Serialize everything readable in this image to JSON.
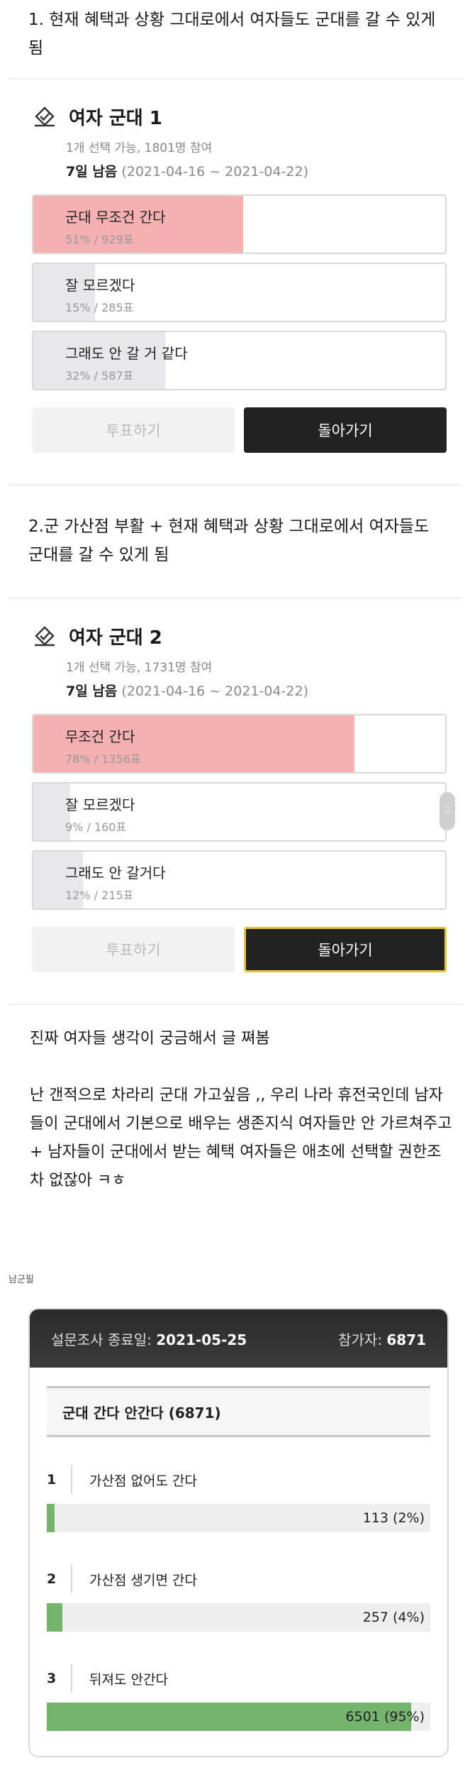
{
  "heading1": "1. 현재 혜택과 상황 그대로에서 여자들도 군대를 갈 수 있게 됨",
  "poll1": {
    "icon": "check-ballot-icon",
    "title": "여자 군대 1",
    "meta": "1개 선택 가능, 1801명 참여",
    "days_left": "7일 남음",
    "range": "(2021-04-16 ~ 2021-04-22)",
    "options": [
      {
        "label": "군대 무조건 간다",
        "count": "51% / 929표",
        "percent": 51
      },
      {
        "label": "잘 모르겠다",
        "count": "15% / 285표",
        "percent": 15
      },
      {
        "label": "그래도 안 갈 거 같다",
        "count": "32% / 587표",
        "percent": 32
      }
    ],
    "vote_label": "투표하기",
    "back_label": "돌아가기"
  },
  "heading2": "2.군 가산점 부활 + 현재 혜택과 상황 그대로에서 여자들도 군대를 갈 수 있게 됨",
  "poll2": {
    "icon": "check-ballot-icon",
    "title": "여자 군대 2",
    "meta": "1개 선택 가능, 1731명 참여",
    "days_left": "7일 남음",
    "range": "(2021-04-16 ~ 2021-04-22)",
    "options": [
      {
        "label": "무조건 간다",
        "count": "78% / 1356표",
        "percent": 78
      },
      {
        "label": "잘 모르겠다",
        "count": "9% / 160표",
        "percent": 9
      },
      {
        "label": "그래도 안 갈거다",
        "count": "12% / 215표",
        "percent": 12
      }
    ],
    "vote_label": "투표하기",
    "back_label": "돌아가기"
  },
  "body": {
    "line1": "진짜 여자들 생각이 궁금해서 글 쪄봄",
    "para2": "난 갠적으로 차라리 군대 가고싶음 ,, 우리 나라 휴전국인데 남자들이 군대에서 기본으로 배우는 생존지식 여자들만 안 가르쳐주고 + 남자들이 군대에서 받는 혜택 여자들은 애초에 선택할 권한조차 없잖아 ㅋㅎ"
  },
  "source_label": "남군필",
  "survey": {
    "end_label": "설문조사 종료일:",
    "end_date": "2021-05-25",
    "participants_label": "참가자:",
    "participants": "6871",
    "question": "군대 간다 안간다 (6871)",
    "items": [
      {
        "num": "1",
        "label": "가산점 없어도 간다",
        "value": "113 (2%)",
        "percent": 2
      },
      {
        "num": "2",
        "label": "가산점 생기면 간다",
        "value": "257 (4%)",
        "percent": 4
      },
      {
        "num": "3",
        "label": "뒤져도 안간다",
        "value": "6501 (95%)",
        "percent": 95
      }
    ]
  },
  "colors": {
    "top_option_fill": "#f5b1b1",
    "other_option_fill": "#e8e8ea",
    "survey_bar_fill": "#75b46c",
    "dark_button": "#222222"
  }
}
